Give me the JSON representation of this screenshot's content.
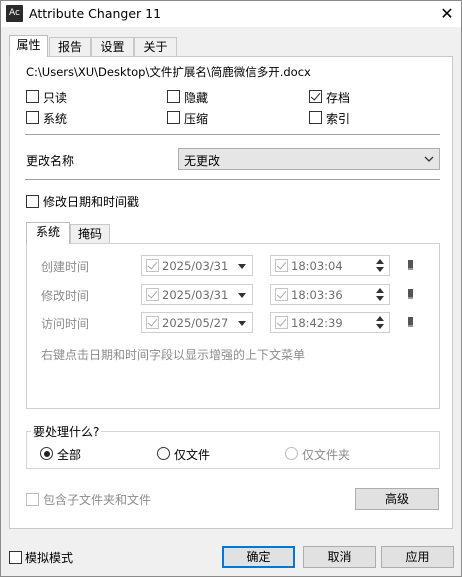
{
  "window": {
    "app_icon_text": "Ac",
    "title": "Attribute Changer 11",
    "close_glyph": "✕"
  },
  "tabs": [
    {
      "label": "属性",
      "active": true
    },
    {
      "label": "报告",
      "active": false
    },
    {
      "label": "设置",
      "active": false
    },
    {
      "label": "关于",
      "active": false
    }
  ],
  "file_path": "C:\\Users\\XU\\Desktop\\文件扩展名\\简鹿微信多开.docx",
  "attributes": [
    {
      "label": "只读",
      "checked": false
    },
    {
      "label": "隐藏",
      "checked": false
    },
    {
      "label": "存档",
      "checked": true
    },
    {
      "label": "系统",
      "checked": false
    },
    {
      "label": "压缩",
      "checked": false
    },
    {
      "label": "索引",
      "checked": false
    }
  ],
  "rename": {
    "label": "更改名称",
    "selected": "无更改"
  },
  "modify_datetime": {
    "label": "修改日期和时间戳",
    "checked": false
  },
  "subtabs": [
    {
      "label": "系统",
      "active": true
    },
    {
      "label": "掩码",
      "active": false
    }
  ],
  "timestamps": [
    {
      "label": "创建时间",
      "date": "2025/03/31",
      "time": "18:03:04"
    },
    {
      "label": "修改时间",
      "date": "2025/03/31",
      "time": "18:03:36"
    },
    {
      "label": "访问时间",
      "date": "2025/05/27",
      "time": "18:42:39"
    }
  ],
  "hint_text": "右键点击日期和时间字段以显示增强的上下文菜单",
  "process": {
    "title": "要处理什么?",
    "options": [
      {
        "label": "全部",
        "selected": true,
        "disabled": false
      },
      {
        "label": "仅文件",
        "selected": false,
        "disabled": false
      },
      {
        "label": "仅文件夹",
        "selected": false,
        "disabled": true
      }
    ]
  },
  "include_subfolders": {
    "label": "包含子文件夹和文件",
    "checked": false
  },
  "advanced_button": "高级",
  "simulation_mode": {
    "label": "模拟模式",
    "checked": false
  },
  "footer_buttons": {
    "ok": "确定",
    "cancel": "取消",
    "apply": "应用"
  },
  "colors": {
    "accent": "#0078d7",
    "window_bg": "#f0f0f0",
    "panel_bg": "#ffffff"
  }
}
